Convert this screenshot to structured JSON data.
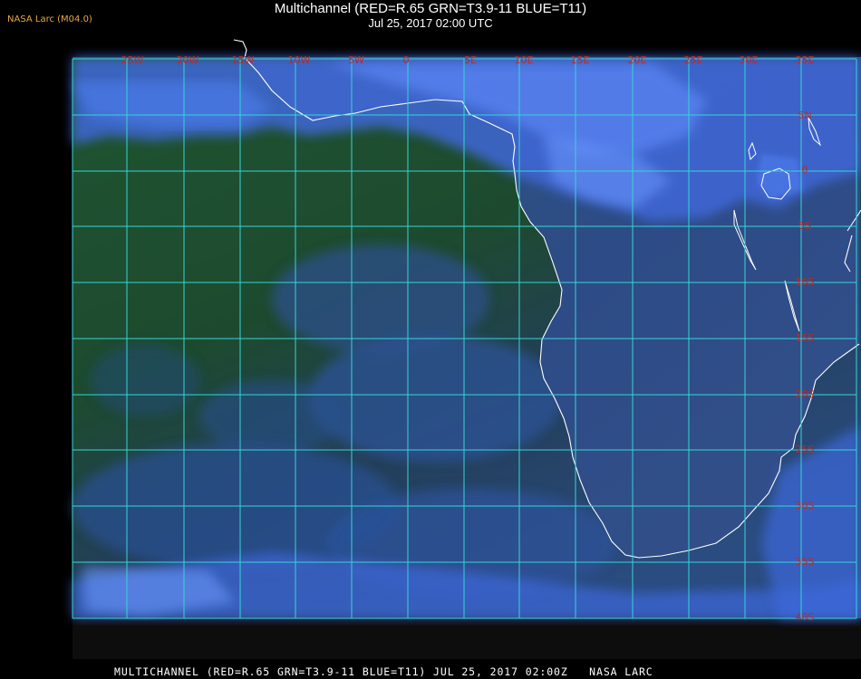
{
  "header": {
    "source_tag": "NASA Larc (M04.0)",
    "title": "Multichannel (RED=R.65 GRN=T3.9-11 BLUE=T11)",
    "datetime": "Jul 25, 2017 02:00 UTC"
  },
  "map": {
    "longitude_labels": [
      "25W",
      "20W",
      "15W",
      "10W",
      "5W",
      "0",
      "5E",
      "10E",
      "15E",
      "20E",
      "25E",
      "30E",
      "35E"
    ],
    "latitude_labels": [
      "5N",
      "0",
      "5S",
      "10S",
      "15S",
      "20S",
      "25S",
      "30S",
      "35S",
      "40S"
    ],
    "colors": {
      "ocean": "#1c4a2e",
      "land": "#2f4d86",
      "cloud": "#4d77ee",
      "grid": "#35d6d6",
      "grid_label": "#c02828",
      "coastline": "#ffffff"
    }
  },
  "footer": {
    "caption": "MULTICHANNEL (RED=R.65 GRN=T3.9-11 BLUE=T11) JUL 25, 2017 02:00Z   NASA LARC"
  }
}
